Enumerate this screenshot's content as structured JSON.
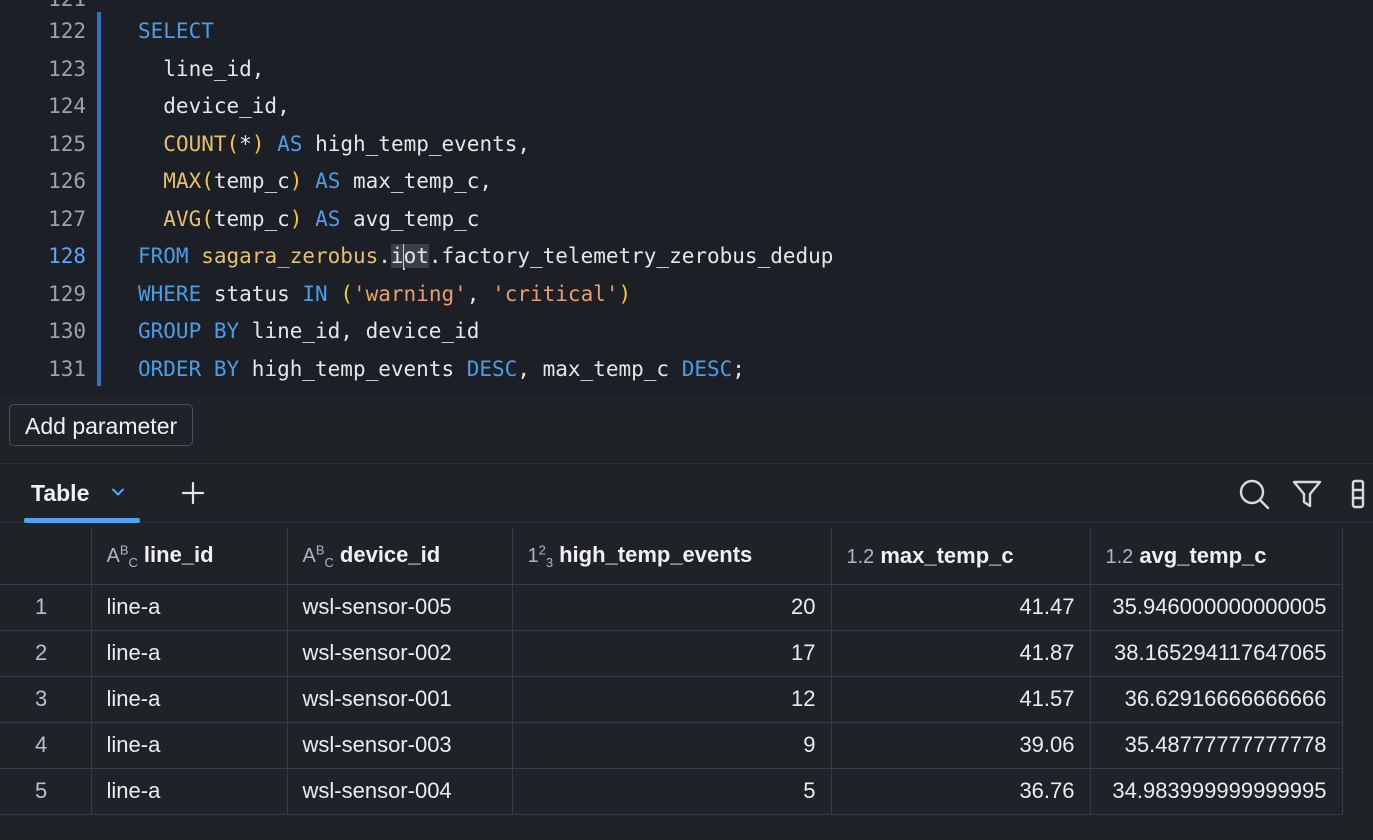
{
  "editor": {
    "lines": [
      {
        "num": "122",
        "tokens": [
          [
            "kw",
            "SELECT"
          ]
        ]
      },
      {
        "num": "123",
        "tokens": [
          [
            "id",
            "  line_id,"
          ]
        ]
      },
      {
        "num": "124",
        "tokens": [
          [
            "id",
            "  device_id,"
          ]
        ]
      },
      {
        "num": "125",
        "tokens": [
          [
            "id",
            "  "
          ],
          [
            "fn",
            "COUNT"
          ],
          [
            "pn",
            "("
          ],
          [
            "id",
            "*"
          ],
          [
            "pn",
            ")"
          ],
          [
            "id",
            " "
          ],
          [
            "kw",
            "AS"
          ],
          [
            "id",
            " high_temp_events,"
          ]
        ]
      },
      {
        "num": "126",
        "tokens": [
          [
            "id",
            "  "
          ],
          [
            "fn",
            "MAX"
          ],
          [
            "pn",
            "("
          ],
          [
            "id",
            "temp_c"
          ],
          [
            "pn",
            ")"
          ],
          [
            "id",
            " "
          ],
          [
            "kw",
            "AS"
          ],
          [
            "id",
            " max_temp_c,"
          ]
        ]
      },
      {
        "num": "127",
        "tokens": [
          [
            "id",
            "  "
          ],
          [
            "fn",
            "AVG"
          ],
          [
            "pn",
            "("
          ],
          [
            "id",
            "temp_c"
          ],
          [
            "pn",
            ")"
          ],
          [
            "id",
            " "
          ],
          [
            "kw",
            "AS"
          ],
          [
            "id",
            " avg_temp_c"
          ]
        ]
      },
      {
        "num": "128",
        "active": true,
        "tokens": [
          [
            "kw",
            "FROM"
          ],
          [
            "id",
            " "
          ],
          [
            "fn",
            "sagara_zerobus"
          ],
          [
            "id",
            "."
          ],
          [
            "hl1",
            "i"
          ],
          [
            "cursor",
            ""
          ],
          [
            "hl2",
            "ot"
          ],
          [
            "id",
            ".factory_telemetry_zerobus_dedup"
          ]
        ]
      },
      {
        "num": "129",
        "tokens": [
          [
            "kw",
            "WHERE"
          ],
          [
            "id",
            " status "
          ],
          [
            "kw",
            "IN"
          ],
          [
            "id",
            " "
          ],
          [
            "pn",
            "("
          ],
          [
            "str",
            "'warning'"
          ],
          [
            "id",
            ", "
          ],
          [
            "str",
            "'critical'"
          ],
          [
            "pn",
            ")"
          ]
        ]
      },
      {
        "num": "130",
        "tokens": [
          [
            "kw",
            "GROUP BY"
          ],
          [
            "id",
            " line_id, device_id"
          ]
        ]
      },
      {
        "num": "131",
        "tokens": [
          [
            "kw",
            "ORDER BY"
          ],
          [
            "id",
            " high_temp_events "
          ],
          [
            "kw",
            "DESC"
          ],
          [
            "id",
            ", max_temp_c "
          ],
          [
            "kw",
            "DESC"
          ],
          [
            "id",
            ";"
          ]
        ]
      }
    ],
    "partial_line_number": "121"
  },
  "add_parameter_label": "Add parameter",
  "results": {
    "tab_label": "Table",
    "icons": [
      "chevron-down-icon",
      "plus-icon",
      "search-icon",
      "filter-icon",
      "columns-icon"
    ],
    "columns": [
      {
        "name": "line_id",
        "type_icon": "string-type-icon",
        "align": "left"
      },
      {
        "name": "device_id",
        "type_icon": "string-type-icon",
        "align": "left"
      },
      {
        "name": "high_temp_events",
        "type_icon": "integer-type-icon",
        "align": "right"
      },
      {
        "name": "max_temp_c",
        "type_icon": "decimal-type-icon",
        "align": "right"
      },
      {
        "name": "avg_temp_c",
        "type_icon": "decimal-type-icon",
        "align": "right"
      }
    ],
    "rows": [
      {
        "index": "1",
        "cells": [
          "line-a",
          "wsl-sensor-005",
          "20",
          "41.47",
          "35.946000000000005"
        ]
      },
      {
        "index": "2",
        "cells": [
          "line-a",
          "wsl-sensor-002",
          "17",
          "41.87",
          "38.165294117647065"
        ]
      },
      {
        "index": "3",
        "cells": [
          "line-a",
          "wsl-sensor-001",
          "12",
          "41.57",
          "36.62916666666666"
        ]
      },
      {
        "index": "4",
        "cells": [
          "line-a",
          "wsl-sensor-003",
          "9",
          "39.06",
          "35.48777777777778"
        ]
      },
      {
        "index": "5",
        "cells": [
          "line-a",
          "wsl-sensor-004",
          "5",
          "36.76",
          "34.983999999999995"
        ]
      }
    ]
  }
}
